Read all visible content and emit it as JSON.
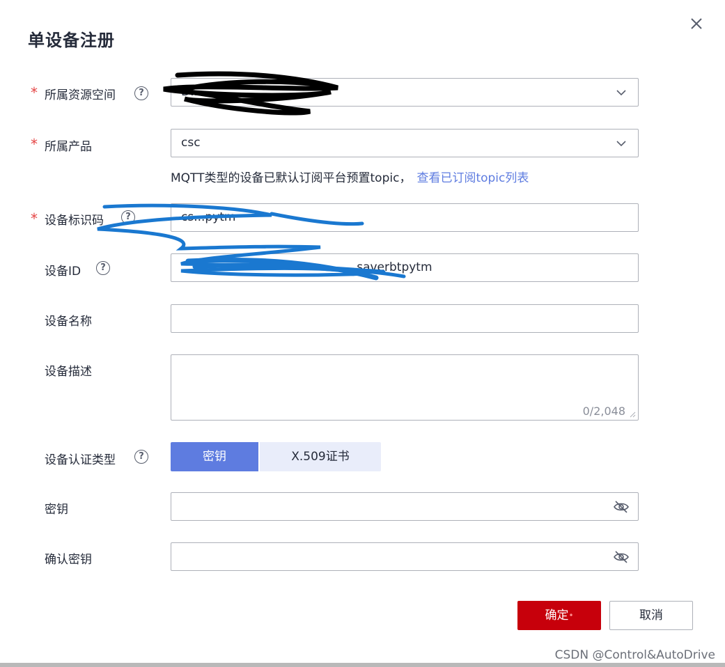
{
  "dialog": {
    "title": "单设备注册",
    "close_icon": "close-icon"
  },
  "form": {
    "required_mark": "*",
    "resource_space": {
      "label": "所属资源空间",
      "value": "D...",
      "redacted": true
    },
    "product": {
      "label": "所属产品",
      "value": "csc"
    },
    "hint": {
      "text": "MQTT类型的设备已默认订阅平台预置topic，",
      "link": "查看已订阅topic列表"
    },
    "node_id": {
      "label": "设备标识码",
      "value": "cs...pytm",
      "redacted": true
    },
    "device_id": {
      "label": "设备ID",
      "value": "...saverbtpytm",
      "redacted": true
    },
    "device_name": {
      "label": "设备名称",
      "value": ""
    },
    "description": {
      "label": "设备描述",
      "value": "",
      "counter": "0/2,048"
    },
    "auth_type": {
      "label": "设备认证类型",
      "options": [
        "密钥",
        "X.509证书"
      ],
      "selected": "密钥"
    },
    "secret": {
      "label": "密钥",
      "value": ""
    },
    "confirm_secret": {
      "label": "确认密钥",
      "value": ""
    }
  },
  "footer": {
    "ok_label": "确定",
    "ok_dot": "•",
    "cancel_label": "取消"
  },
  "watermark": "CSDN @Control&AutoDrive",
  "colors": {
    "primary_blue": "#5e7ce0",
    "danger_red": "#c7000b",
    "required_red": "#e54545",
    "border": "#adb0b8",
    "redaction_black": "#000000",
    "redaction_blue": "#1a78d0"
  }
}
